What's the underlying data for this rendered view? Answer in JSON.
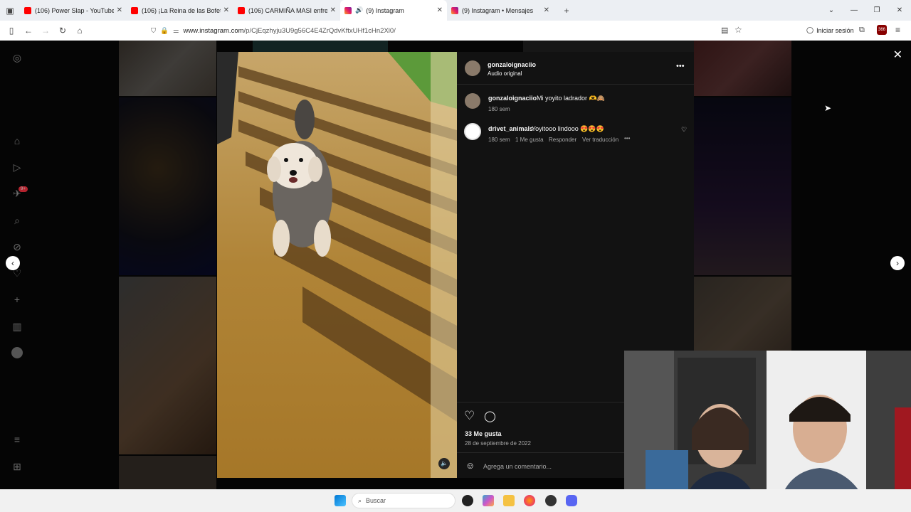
{
  "browser": {
    "tabs": [
      {
        "label": "(106) Power Slap - YouTube",
        "icon": "youtube-icon"
      },
      {
        "label": "(106) ¡La Reina de las Bofetadas",
        "icon": "youtube-icon"
      },
      {
        "label": "(106) CARMIÑA MASI enfrentó",
        "icon": "youtube-icon"
      },
      {
        "label": "(9) Instagram",
        "icon": "instagram-icon",
        "active": true
      },
      {
        "label": "(9) Instagram • Mensajes",
        "icon": "instagram-icon"
      }
    ],
    "url_domain": "www.instagram.com",
    "url_path": "/p/CjEqzhyju3U9g56C4E4ZrQdvKftxUHf1cHn2Xl0/",
    "signin_label": "Iniciar sesión",
    "badge_count": "366"
  },
  "post": {
    "username": "gonzaloignaciio",
    "audio": "Audio original",
    "caption_user": "gonzaloignaciio",
    "caption_text": "Mi yoyito ladrador 🫶🙈",
    "caption_time": "180 sem",
    "comments": [
      {
        "user": "drivet_animals",
        "text": "Yoyitooo lindooo 😍😍😍",
        "time": "180 sem",
        "likes": "1 Me gusta",
        "reply": "Responder",
        "translate": "Ver traducción"
      }
    ],
    "likes": "33 Me gusta",
    "date": "28 de septiembre de 2022",
    "comment_placeholder": "Agrega un comentario..."
  },
  "sidebar": {
    "notification_badge": "9+"
  },
  "taskbar": {
    "search_placeholder": "Buscar"
  },
  "colors": {
    "panel_bg": "#121212",
    "instagram_accent": "#e1306c",
    "youtube": "#ff0000"
  }
}
